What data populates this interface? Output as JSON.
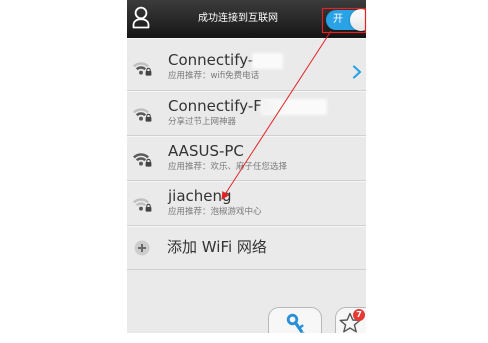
{
  "header": {
    "user_icon": "user-icon",
    "title": "成功连接到互联网",
    "toggle_label": "开",
    "toggle_on": true
  },
  "networks": [
    {
      "ssid": "Connectify-",
      "subtitle": "应用推荐：wifi免费电话",
      "signal": 2,
      "signal_max": 3,
      "locked": true,
      "icon": "wifi-locked-icon",
      "action_icon": "chevron-right-icon"
    },
    {
      "ssid": "Connectify-F",
      "subtitle": "分享过节上网神器",
      "signal": 2,
      "signal_max": 3,
      "locked": true,
      "icon": "wifi-locked-icon"
    },
    {
      "ssid": "AASUS-PC",
      "subtitle": "应用推荐：欢乐、麻子任您选择",
      "signal": 3,
      "signal_max": 3,
      "locked": true,
      "icon": "wifi-locked-icon"
    },
    {
      "ssid": "jiacheng",
      "subtitle": "应用推荐：泡椒游戏中心",
      "signal": 1,
      "signal_max": 3,
      "locked": true,
      "icon": "wifi-locked-icon"
    }
  ],
  "add_network": {
    "icon": "plus-icon",
    "label": "添加 WiFi 网络"
  },
  "bottom_tabs": [
    {
      "icon": "key-icon"
    },
    {
      "icon": "star-icon",
      "badge": "7"
    }
  ],
  "colors": {
    "accent": "#2aa2e6",
    "header_bg": "#1c1c1c",
    "list_bg": "#eaeaea",
    "signal_active": "#5a5a5a",
    "signal_inactive": "#c0c0c0",
    "badge": "#e53935",
    "annotation": "#e32222"
  }
}
